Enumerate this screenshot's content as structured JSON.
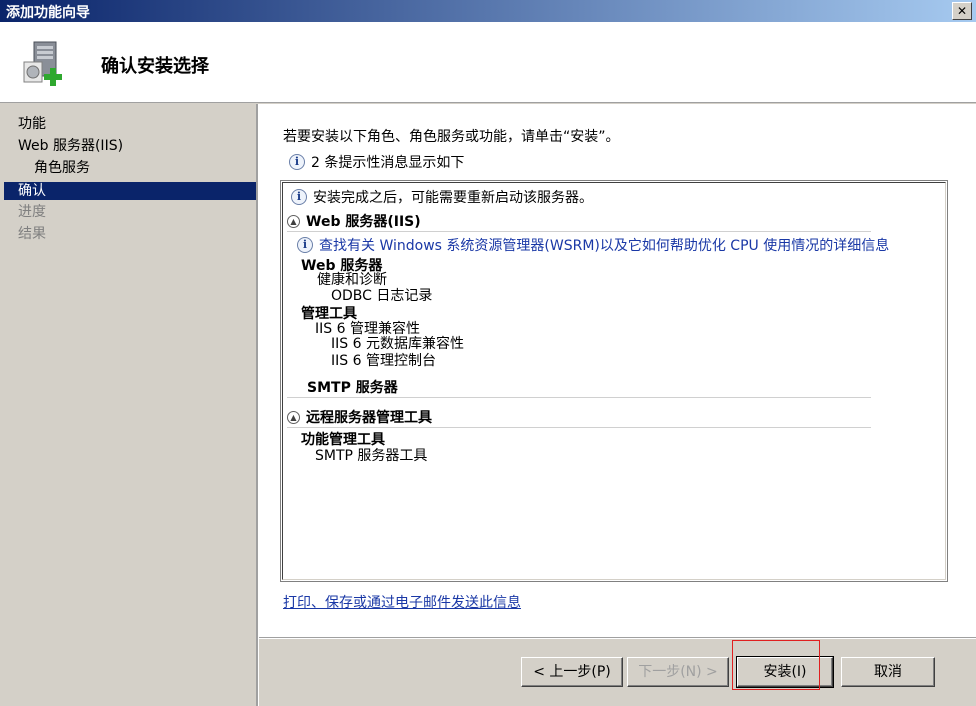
{
  "window": {
    "title": "添加功能向导",
    "close_label": "✕"
  },
  "header": {
    "page_title": "确认安装选择",
    "icon": "server-add-icon"
  },
  "leftnav": {
    "items": [
      {
        "label": "功能",
        "state": "normal"
      },
      {
        "label": "Web 服务器(IIS)",
        "state": "normal"
      },
      {
        "label": "角色服务",
        "state": "sub"
      },
      {
        "label": "确认",
        "state": "active"
      },
      {
        "label": "进度",
        "state": "disabled"
      },
      {
        "label": "结果",
        "state": "disabled"
      }
    ]
  },
  "main": {
    "intro": "若要安装以下角色、角色服务或功能，请单击“安装”。",
    "info_count": "2 条提示性消息显示如下",
    "details": {
      "restart_note": "安装完成之后，可能需要重新启动该服务器。",
      "section1_title": "Web 服务器(IIS)",
      "wsrm_link": "查找有关 Windows 系统资源管理器(WSRM)以及它如何帮助优化 CPU 使用情况的详细信息",
      "web_server": "Web 服务器",
      "health": "健康和诊断",
      "odbc": "ODBC 日志记录",
      "mgmt_tools": "管理工具",
      "iis6_compat": "IIS 6 管理兼容性",
      "iis6_meta": "IIS 6 元数据库兼容性",
      "iis6_console": "IIS 6 管理控制台",
      "smtp_server": "SMTP 服务器",
      "section2_title": "远程服务器管理工具",
      "feature_mgmt": "功能管理工具",
      "smtp_tools": "SMTP 服务器工具"
    },
    "print_link": "打印、保存或通过电子邮件发送此信息"
  },
  "buttons": {
    "prev": "< 上一步(P)",
    "next": "下一步(N) >",
    "install": "安装(I)",
    "cancel": "取消"
  },
  "colors": {
    "accent": "#0a246a",
    "link": "#1a38a6",
    "highlight": "#e02020"
  }
}
